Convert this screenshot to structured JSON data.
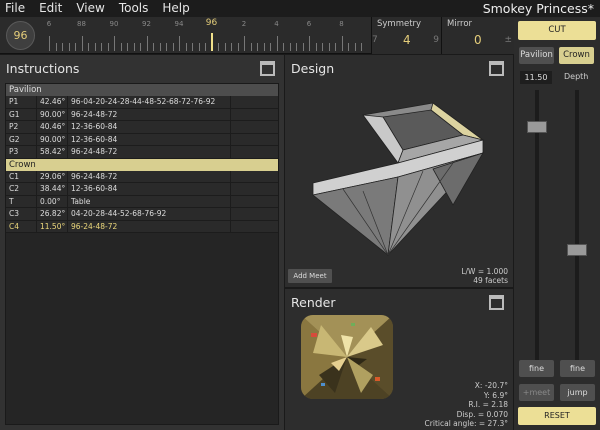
{
  "menu": {
    "items": [
      "File",
      "Edit",
      "View",
      "Tools",
      "Help"
    ],
    "title": "Smokey Princess*"
  },
  "toolbar": {
    "index_value": "96",
    "ruler_labels": [
      "6",
      "88",
      "90",
      "92",
      "94",
      "96",
      "2",
      "4",
      "6",
      "8"
    ],
    "selected_label": "96",
    "symmetry_title": "Symmetry",
    "symmetry_value": "4",
    "symmetry_left": "7",
    "symmetry_right": "9",
    "mirror_title": "Mirror",
    "mirror_value": "0",
    "mirror_edge": "±"
  },
  "instructions": {
    "title": "Instructions",
    "pavilion_label": "Pavilion",
    "crown_label": "Crown",
    "pavilion_rows": [
      {
        "name": "P1",
        "angle": "42.46°",
        "indexes": "96-04-20-24-28-44-48-52-68-72-76-92"
      },
      {
        "name": "G1",
        "angle": "90.00°",
        "indexes": "96-24-48-72"
      },
      {
        "name": "P2",
        "angle": "40.46°",
        "indexes": "12-36-60-84"
      },
      {
        "name": "G2",
        "angle": "90.00°",
        "indexes": "12-36-60-84"
      },
      {
        "name": "P3",
        "angle": "58.42°",
        "indexes": "96-24-48-72"
      }
    ],
    "crown_rows": [
      {
        "name": "C1",
        "angle": "29.06°",
        "indexes": "96-24-48-72"
      },
      {
        "name": "C2",
        "angle": "38.44°",
        "indexes": "12-36-60-84"
      },
      {
        "name": "T",
        "angle": "0.00°",
        "indexes": "Table"
      },
      {
        "name": "C3",
        "angle": "26.82°",
        "indexes": "04-20-28-44-52-68-76-92"
      },
      {
        "name": "C4",
        "angle": "11.50°",
        "indexes": "96-24-48-72"
      }
    ]
  },
  "design": {
    "title": "Design",
    "add_meet_label": "Add Meet",
    "lw_ratio": "L/W = 1.000",
    "facets": "49 facets"
  },
  "render": {
    "title": "Render",
    "x": "X: -20.7°",
    "y": "Y: 6.9°",
    "ri": "R.I. = 2.18",
    "disp": "Disp. = 0.070",
    "critical": "Critical angle: = 27.3°"
  },
  "controls": {
    "cut_label": "CUT",
    "pavilion_label": "Pavilion",
    "crown_label": "Crown",
    "angle_value": "11.50",
    "depth_label": "Depth",
    "fine_left": "fine",
    "fine_right": "fine",
    "meet_label": "+meet",
    "jump_label": "jump",
    "reset_label": "RESET"
  },
  "colors": {
    "accent": "#ecdf96",
    "selected_text": "#e4cd7a",
    "crown_header": "#d8cf90"
  }
}
